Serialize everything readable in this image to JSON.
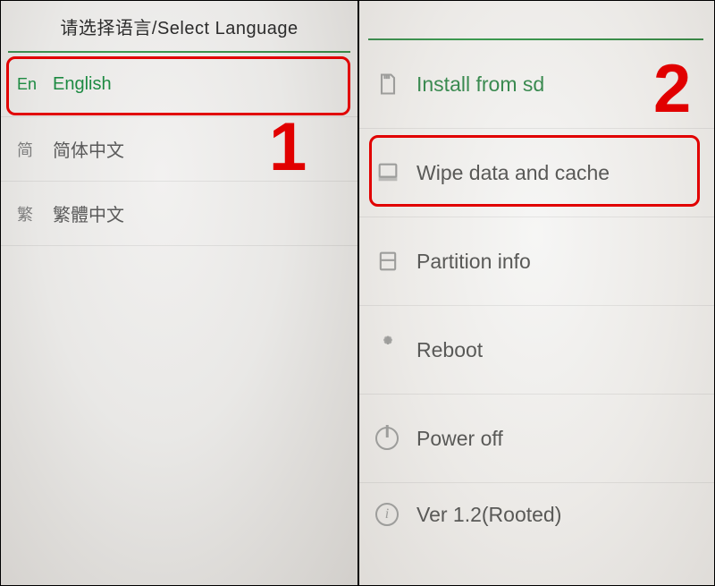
{
  "left_panel": {
    "title": "请选择语言/Select Language",
    "items": [
      {
        "prefix": "En",
        "label": "English",
        "selected": true
      },
      {
        "prefix": "简",
        "label": "简体中文",
        "selected": false
      },
      {
        "prefix": "繁",
        "label": "繁體中文",
        "selected": false
      }
    ]
  },
  "right_panel": {
    "items": [
      {
        "icon": "sd-card-icon",
        "label": "Install from sd"
      },
      {
        "icon": "wipe-icon",
        "label": "Wipe data and cache"
      },
      {
        "icon": "partition-icon",
        "label": "Partition info"
      },
      {
        "icon": "spinner-icon",
        "label": "Reboot"
      },
      {
        "icon": "power-icon",
        "label": "Power off"
      },
      {
        "icon": "info-icon",
        "label": "Ver 1.2(Rooted)"
      }
    ]
  },
  "annotations": {
    "step1": "1",
    "step2": "2"
  }
}
